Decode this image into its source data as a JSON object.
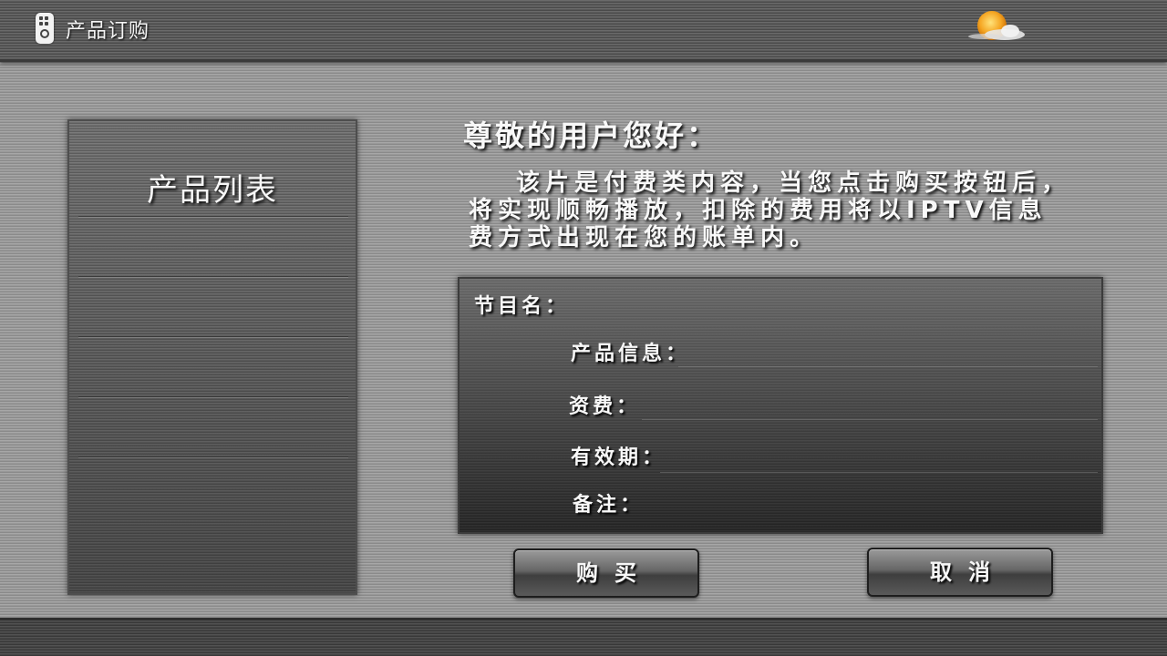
{
  "header": {
    "title": "产品订购",
    "left_icon": "remote-control-icon",
    "right_icon": "weather-sun-cloud-icon"
  },
  "product_list": {
    "title": "产品列表",
    "items": []
  },
  "main": {
    "greeting": "尊敬的用户您好：",
    "notice": "该片是付费类内容，当您点击购买按钮后，将实现顺畅播放，扣除的费用将以IPTV信息费方式出现在您的账单内。"
  },
  "details": {
    "program_name_label": "节目名：",
    "product_info_label": "产品信息：",
    "fee_label": "资费：",
    "validity_label": "有效期：",
    "remarks_label": "备注："
  },
  "buttons": {
    "buy": "购买",
    "cancel": "取消"
  },
  "colors": {
    "sun": "#f5a623",
    "text": "#f8f8f8"
  }
}
